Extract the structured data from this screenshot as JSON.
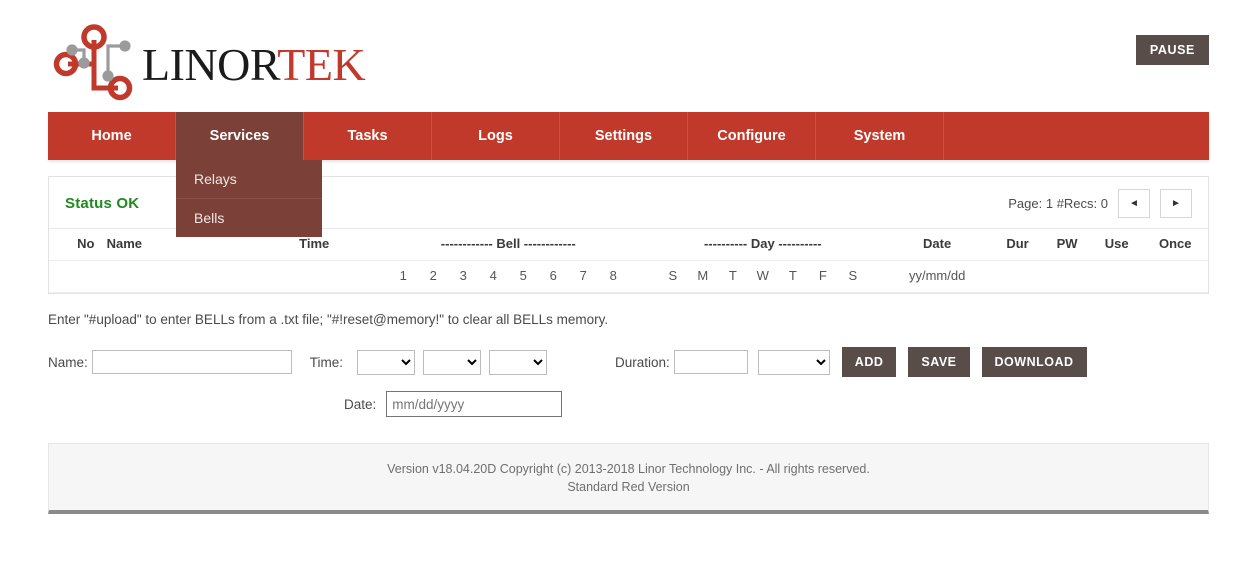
{
  "header": {
    "logo_text_dark": "LINOR",
    "logo_text_red": "TEK",
    "logo_icon": "circuit-node-logo",
    "pause_label": "PAUSE"
  },
  "nav": {
    "items": [
      {
        "label": "Home",
        "active": false
      },
      {
        "label": "Services",
        "active": true
      },
      {
        "label": "Tasks",
        "active": false
      },
      {
        "label": "Logs",
        "active": false
      },
      {
        "label": "Settings",
        "active": false
      },
      {
        "label": "Configure",
        "active": false
      },
      {
        "label": "System",
        "active": false
      }
    ],
    "dropdown": {
      "items": [
        {
          "label": "Relays"
        },
        {
          "label": "Bells"
        }
      ]
    }
  },
  "panel": {
    "status_title": "Status OK",
    "pager_text": "Page: 1 #Recs: 0",
    "prev_label": "◄",
    "next_label": "►"
  },
  "table": {
    "headers": {
      "no": "No",
      "name": "Name",
      "time": "Time",
      "bell": "------------ Bell ------------",
      "day": "---------- Day ----------",
      "date": "Date",
      "dur": "Dur",
      "pw": "PW",
      "use": "Use",
      "once": "Once"
    },
    "sub": {
      "bell_numbers": [
        "1",
        "2",
        "3",
        "4",
        "5",
        "6",
        "7",
        "8"
      ],
      "day_letters": [
        "S",
        "M",
        "T",
        "W",
        "T",
        "F",
        "S"
      ],
      "date_format": "yy/mm/dd"
    }
  },
  "hint": "Enter \"#upload\" to enter BELLs from a .txt file; \"#!reset@memory!\" to clear all BELLs memory.",
  "form": {
    "name_label": "Name:",
    "name_value": "",
    "time_label": "Time:",
    "time_selects": [
      {
        "value": ""
      },
      {
        "value": ""
      },
      {
        "value": ""
      }
    ],
    "duration_label": "Duration:",
    "duration_value": "",
    "duration_unit": "",
    "date_label": "Date:",
    "date_placeholder": "mm/dd/yyyy",
    "date_value": "",
    "add_label": "ADD",
    "save_label": "SAVE",
    "download_label": "DOWNLOAD"
  },
  "footer": {
    "line1": "Version v18.04.20D Copyright (c) 2013-2018 Linor Technology Inc. - All rights reserved.",
    "line2": "Standard Red Version"
  },
  "colors": {
    "brand_red": "#c0392b",
    "nav_active": "#7b4038",
    "button_dark": "#584d48",
    "status_green": "#1f8b1f"
  }
}
